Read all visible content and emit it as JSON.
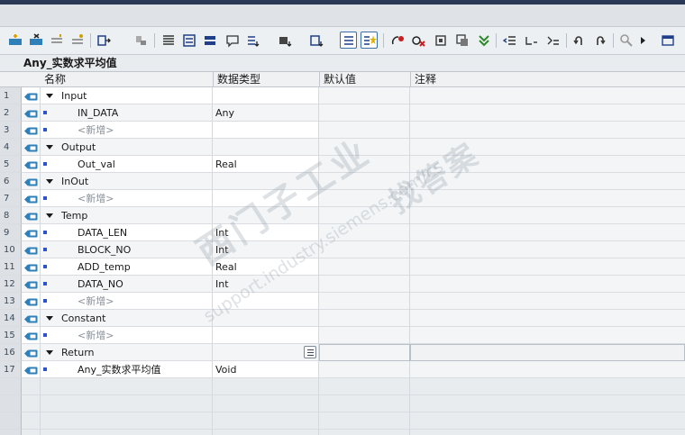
{
  "block_title": "Any_实数求平均值",
  "columns": {
    "name": "名称",
    "data_type": "数据类型",
    "default_value": "默认值",
    "comment": "注释"
  },
  "rows": [
    {
      "num": "1",
      "kind": "section",
      "name": "Input",
      "type": ""
    },
    {
      "num": "2",
      "kind": "var",
      "name": "IN_DATA",
      "type": "Any"
    },
    {
      "num": "3",
      "kind": "add",
      "name": "<新增>",
      "type": ""
    },
    {
      "num": "4",
      "kind": "section",
      "name": "Output",
      "type": ""
    },
    {
      "num": "5",
      "kind": "var",
      "name": "Out_val",
      "type": "Real"
    },
    {
      "num": "6",
      "kind": "section",
      "name": "InOut",
      "type": ""
    },
    {
      "num": "7",
      "kind": "add",
      "name": "<新增>",
      "type": ""
    },
    {
      "num": "8",
      "kind": "section",
      "name": "Temp",
      "type": ""
    },
    {
      "num": "9",
      "kind": "var",
      "name": "DATA_LEN",
      "type": "Int"
    },
    {
      "num": "10",
      "kind": "var",
      "name": "BLOCK_NO",
      "type": "Int"
    },
    {
      "num": "11",
      "kind": "var",
      "name": "ADD_temp",
      "type": "Real"
    },
    {
      "num": "12",
      "kind": "var",
      "name": "DATA_NO",
      "type": "Int"
    },
    {
      "num": "13",
      "kind": "add",
      "name": "<新增>",
      "type": ""
    },
    {
      "num": "14",
      "kind": "section",
      "name": "Constant",
      "type": ""
    },
    {
      "num": "15",
      "kind": "add",
      "name": "<新增>",
      "type": ""
    },
    {
      "num": "16",
      "kind": "section",
      "name": "Return",
      "type": ""
    },
    {
      "num": "17",
      "kind": "var",
      "name": "Any_实数求平均值",
      "type": "Void"
    }
  ],
  "watermark": {
    "line1": "西门子工业",
    "line2": "support.industry.siemens.com/cs",
    "line3": "找答案"
  },
  "colors": {
    "accent": "#2a54c8",
    "section_icon": "#2f7fb8",
    "title_bar": "#2a3a56"
  }
}
